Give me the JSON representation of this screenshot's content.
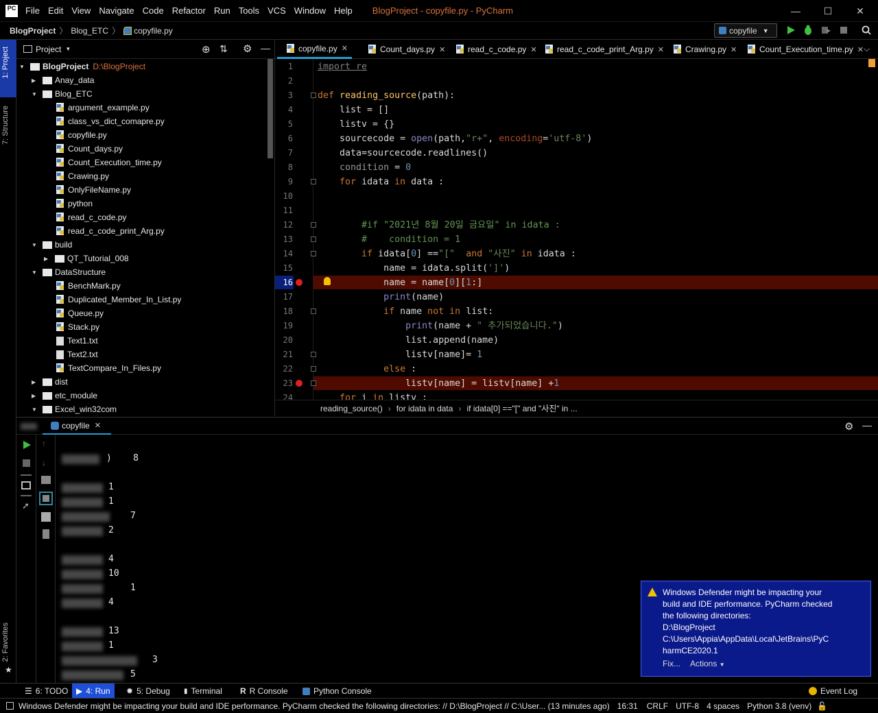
{
  "menu": {
    "logo": "PC",
    "items": [
      "File",
      "Edit",
      "View",
      "Navigate",
      "Code",
      "Refactor",
      "Run",
      "Tools",
      "VCS",
      "Window",
      "Help"
    ],
    "window_title": "BlogProject - copyfile.py - PyCharm"
  },
  "breadcrumbs": [
    "BlogProject",
    "Blog_ETC",
    "copyfile.py"
  ],
  "run_config": "copyfile",
  "left_strip": {
    "project_tab": "1: Project",
    "structure_tab": "7: Structure",
    "favorites_tab": "2: Favorites"
  },
  "project": {
    "header": "Project",
    "root_name": "BlogProject",
    "root_path": "D:\\BlogProject",
    "tree": [
      {
        "label": "Anay_data",
        "type": "folder",
        "depth": 1,
        "state": "collapsed"
      },
      {
        "label": "Blog_ETC",
        "type": "folder",
        "depth": 1,
        "state": "expanded"
      },
      {
        "label": "argument_example.py",
        "type": "py",
        "depth": 2
      },
      {
        "label": "class_vs_dict_comapre.py",
        "type": "py",
        "depth": 2
      },
      {
        "label": "copyfile.py",
        "type": "py",
        "depth": 2
      },
      {
        "label": "Count_days.py",
        "type": "py",
        "depth": 2
      },
      {
        "label": "Count_Execution_time.py",
        "type": "py",
        "depth": 2
      },
      {
        "label": "Crawing.py",
        "type": "py",
        "depth": 2
      },
      {
        "label": "OnlyFileName.py",
        "type": "py",
        "depth": 2
      },
      {
        "label": "python",
        "type": "py",
        "depth": 2
      },
      {
        "label": "read_c_code.py",
        "type": "py",
        "depth": 2
      },
      {
        "label": "read_c_code_print_Arg.py",
        "type": "py",
        "depth": 2
      },
      {
        "label": "build",
        "type": "folder",
        "depth": 1,
        "state": "expanded"
      },
      {
        "label": "QT_Tutorial_008",
        "type": "folder",
        "depth": 2,
        "state": "collapsed"
      },
      {
        "label": "DataStructure",
        "type": "folder",
        "depth": 1,
        "state": "expanded"
      },
      {
        "label": "BenchMark.py",
        "type": "py",
        "depth": 2
      },
      {
        "label": "Duplicated_Member_In_List.py",
        "type": "py",
        "depth": 2
      },
      {
        "label": "Queue.py",
        "type": "py",
        "depth": 2
      },
      {
        "label": "Stack.py",
        "type": "py",
        "depth": 2
      },
      {
        "label": "Text1.txt",
        "type": "txt",
        "depth": 2
      },
      {
        "label": "Text2.txt",
        "type": "txt",
        "depth": 2
      },
      {
        "label": "TextCompare_In_Files.py",
        "type": "py",
        "depth": 2
      },
      {
        "label": "dist",
        "type": "folder",
        "depth": 1,
        "state": "collapsed"
      },
      {
        "label": "etc_module",
        "type": "folder",
        "depth": 1,
        "state": "collapsed"
      },
      {
        "label": "Excel_win32com",
        "type": "folder",
        "depth": 1,
        "state": "expanded"
      }
    ]
  },
  "editor_tabs": [
    "copyfile.py",
    "Count_days.py",
    "read_c_code.py",
    "read_c_code_print_Arg.py",
    "Crawing.py",
    "Count_Execution_time.py"
  ],
  "code": [
    {
      "n": "1",
      "html": "<span style=\"color:#808080;text-decoration:underline\">import re</span>"
    },
    {
      "n": "2",
      "html": ""
    },
    {
      "n": "3",
      "html": "<span class=\"kw\">def</span> <span style=\"color:#ffc66d\">reading_source</span>(path):"
    },
    {
      "n": "4",
      "html": "    list = []"
    },
    {
      "n": "5",
      "html": "    listv = {}"
    },
    {
      "n": "6",
      "html": "    sourcecode = <span class=\"bi\">open</span>(path,<span class=\"str\">\"r+\"</span>, <span class=\"kwarg\">encoding</span>=<span class=\"str\">'utf-8'</span>)"
    },
    {
      "n": "7",
      "html": "    data=sourcecode.readlines()"
    },
    {
      "n": "8",
      "html": "    <span style=\"color:#999\">condition</span> = <span class=\"num\">0</span>"
    },
    {
      "n": "9",
      "html": "    <span class=\"kw\">for</span> idata <span class=\"kw\">in</span> data :"
    },
    {
      "n": "10",
      "html": ""
    },
    {
      "n": "11",
      "html": ""
    },
    {
      "n": "12",
      "html": "        <span class=\"cmt\">#if \"2021년 8월 20일 금요일\" in idata :</span>"
    },
    {
      "n": "13",
      "html": "        <span class=\"cmt\">#    condition = 1</span>"
    },
    {
      "n": "14",
      "html": "        <span class=\"kw\">if</span> idata[<span class=\"num\">0</span>] ==<span class=\"str\">\"[\"</span>  <span class=\"kw\">and</span> <span class=\"str\">\"사진\"</span> <span class=\"kw\">in</span> idata :"
    },
    {
      "n": "15",
      "html": "            name = idata.split(<span class=\"str\">']'</span>)"
    },
    {
      "n": "16",
      "html": "            name = name[<span class=\"num\">0</span>][<span class=\"num\">1</span>:]"
    },
    {
      "n": "17",
      "html": "            <span class=\"bi\">print</span>(name)"
    },
    {
      "n": "18",
      "html": "            <span class=\"kw\">if</span> name <span class=\"kw\">not in</span> list:"
    },
    {
      "n": "19",
      "html": "                <span class=\"bi\">print</span>(name + <span class=\"str\">\" 추가되었습니다.\"</span>)"
    },
    {
      "n": "20",
      "html": "                list.append(name)"
    },
    {
      "n": "21",
      "html": "                listv[name]= <span class=\"num\">1</span>"
    },
    {
      "n": "22",
      "html": "            <span class=\"kw\">else</span> :"
    },
    {
      "n": "23",
      "html": "                listv[name] = listv[name] +<span class=\"num\">1</span>"
    },
    {
      "n": "24",
      "html": "    <span class=\"kw\">for</span> i <span class=\"kw\">in</span> listv :"
    }
  ],
  "current_line": "16",
  "editor_breadcrumbs": [
    "reading_source()",
    "for idata in data",
    "if idata[0] ==\"[\"  and \"사진\" in ..."
  ],
  "run_panel": {
    "tab_label": "copyfile",
    "output": [
      ")    8",
      "1",
      "1",
      "7",
      "2",
      "4",
      "10",
      "1",
      "4",
      "13",
      "1",
      "3",
      "5"
    ]
  },
  "notification": {
    "text_lines": [
      "Windows Defender might be impacting your",
      "build and IDE performance. PyCharm checked",
      "the following directories:",
      "D:\\BlogProject",
      "C:\\Users\\Appia\\AppData\\Local\\JetBrains\\PyC",
      "harmCE2020.1"
    ],
    "fix": "Fix...",
    "actions": "Actions"
  },
  "bottom_tabs": {
    "todo": "6: TODO",
    "run": "4: Run",
    "debug": "5: Debug",
    "terminal": "Terminal",
    "rconsole": "R Console",
    "pyconsole": "Python Console",
    "eventlog": "Event Log"
  },
  "status": {
    "message": "Windows Defender might be impacting your build and IDE performance. PyCharm checked the following directories: // D:\\BlogProject // C:\\User... (13 minutes ago)",
    "position": "16:31",
    "line_sep": "CRLF",
    "encoding": "UTF-8",
    "indent": "4 spaces",
    "interpreter": "Python 3.8 (venv)"
  },
  "colors": {
    "accent": "#d9733b",
    "breakpoint_line": "#4f0b00",
    "notification_bg": "#0b1a8a",
    "run_tab_active": "#1f4fd8"
  }
}
